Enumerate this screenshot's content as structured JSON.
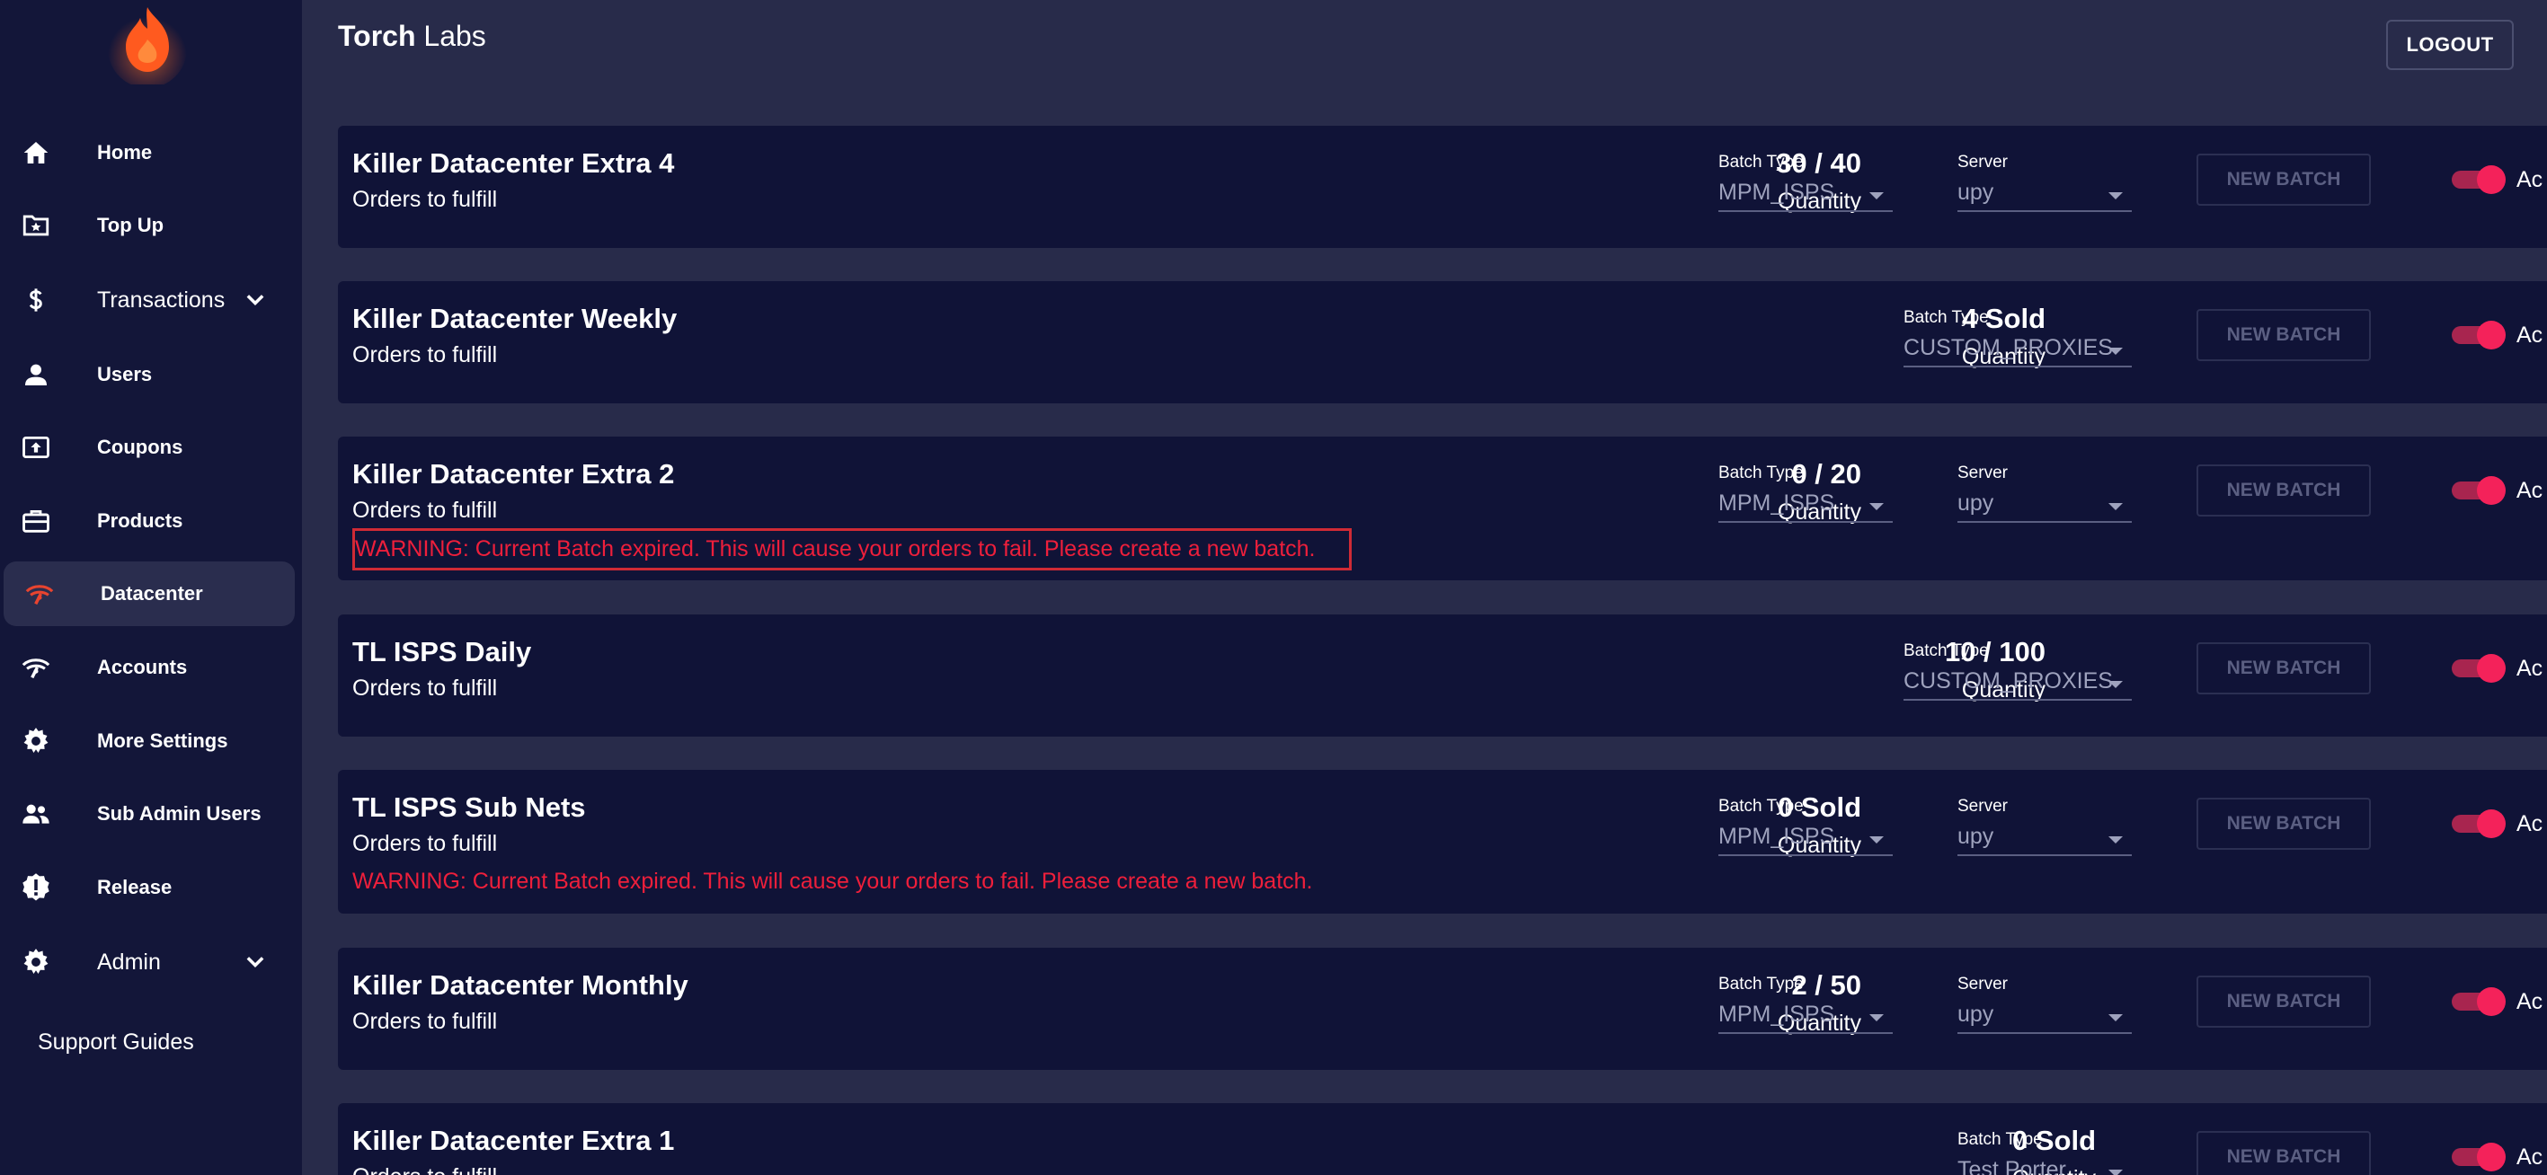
{
  "brand": {
    "bold": "Torch",
    "rest": " Labs"
  },
  "header": {
    "logout_label": "LOGOUT"
  },
  "sidebar": {
    "items": [
      {
        "label": "Home"
      },
      {
        "label": "Top Up"
      },
      {
        "label": "Transactions"
      },
      {
        "label": "Users"
      },
      {
        "label": "Coupons"
      },
      {
        "label": "Products"
      },
      {
        "label": "Datacenter"
      },
      {
        "label": "Accounts"
      },
      {
        "label": "More Settings"
      },
      {
        "label": "Sub Admin Users"
      },
      {
        "label": "Release"
      },
      {
        "label": "Admin"
      }
    ],
    "support_label": "Support Guides",
    "active_item": "Datacenter"
  },
  "cards": [
    {
      "title": "Killer Datacenter Extra 4",
      "subtitle": "Orders to fulfill",
      "count": "30 / 40",
      "count_label": "Quantity",
      "batch_type_label": "Batch Type",
      "batch_type": "MPM_ISPS",
      "server_label": "Server",
      "server": "upy",
      "button": "NEW BATCH",
      "toggle_label": "Ac",
      "active": true
    },
    {
      "title": "Killer Datacenter Weekly",
      "subtitle": "Orders to fulfill",
      "count": "4 Sold",
      "count_label": "Quantity",
      "batch_type_label": "Batch Type",
      "batch_type": "CUSTOM_PROXIES",
      "button": "NEW BATCH",
      "toggle_label": "Ac",
      "active": true
    },
    {
      "title": "Killer Datacenter Extra 2",
      "subtitle": "Orders to fulfill",
      "warning": "WARNING: Current Batch expired. This will cause your orders to fail. Please create a new batch.",
      "count": "0 / 20",
      "count_label": "Quantity",
      "batch_type_label": "Batch Type",
      "batch_type": "MPM_ISPS",
      "server_label": "Server",
      "server": "upy",
      "button": "NEW BATCH",
      "toggle_label": "Ac",
      "active": true
    },
    {
      "title": "TL ISPS Daily",
      "subtitle": "Orders to fulfill",
      "count": "10 / 100",
      "count_label": "Quantity",
      "batch_type_label": "Batch Type",
      "batch_type": "CUSTOM_PROXIES",
      "button": "NEW BATCH",
      "toggle_label": "Ac",
      "active": true
    },
    {
      "title": "TL ISPS Sub Nets",
      "subtitle": "Orders to fulfill",
      "warning": "WARNING: Current Batch expired. This will cause your orders to fail. Please create a new batch.",
      "count": "0 Sold",
      "count_label": "Quantity",
      "batch_type_label": "Batch Type",
      "batch_type": "MPM_ISPS",
      "server_label": "Server",
      "server": "upy",
      "button": "NEW BATCH",
      "toggle_label": "Ac",
      "active": true
    },
    {
      "title": "Killer Datacenter Monthly",
      "subtitle": "Orders to fulfill",
      "count": "2 / 50",
      "count_label": "Quantity",
      "batch_type_label": "Batch Type",
      "batch_type": "MPM_ISPS",
      "server_label": "Server",
      "server": "upy",
      "button": "NEW BATCH",
      "toggle_label": "Ac",
      "active": true
    },
    {
      "title": "Killer Datacenter Extra 1",
      "subtitle": "Orders to fulfill",
      "count": "0 Sold",
      "count_label": "Quantity",
      "batch_type_label": "Batch Type",
      "batch_type": "Test Porter",
      "button": "NEW BATCH",
      "toggle_label": "Ac",
      "active": true
    }
  ],
  "colors": {
    "accent": "#f4225a",
    "warning": "#ee1f3b",
    "logo": "#ff5a1f",
    "sidebar": "#131639",
    "card": "#101337"
  },
  "icons": [
    "home-icon",
    "folder-star-icon",
    "dollar-icon",
    "user-icon",
    "coupon-icon",
    "briefcase-icon",
    "signal-icon",
    "signal-icon",
    "gear-icon",
    "users-icon",
    "badge-alert-icon",
    "gear-icon",
    "chevron-down-icon"
  ]
}
